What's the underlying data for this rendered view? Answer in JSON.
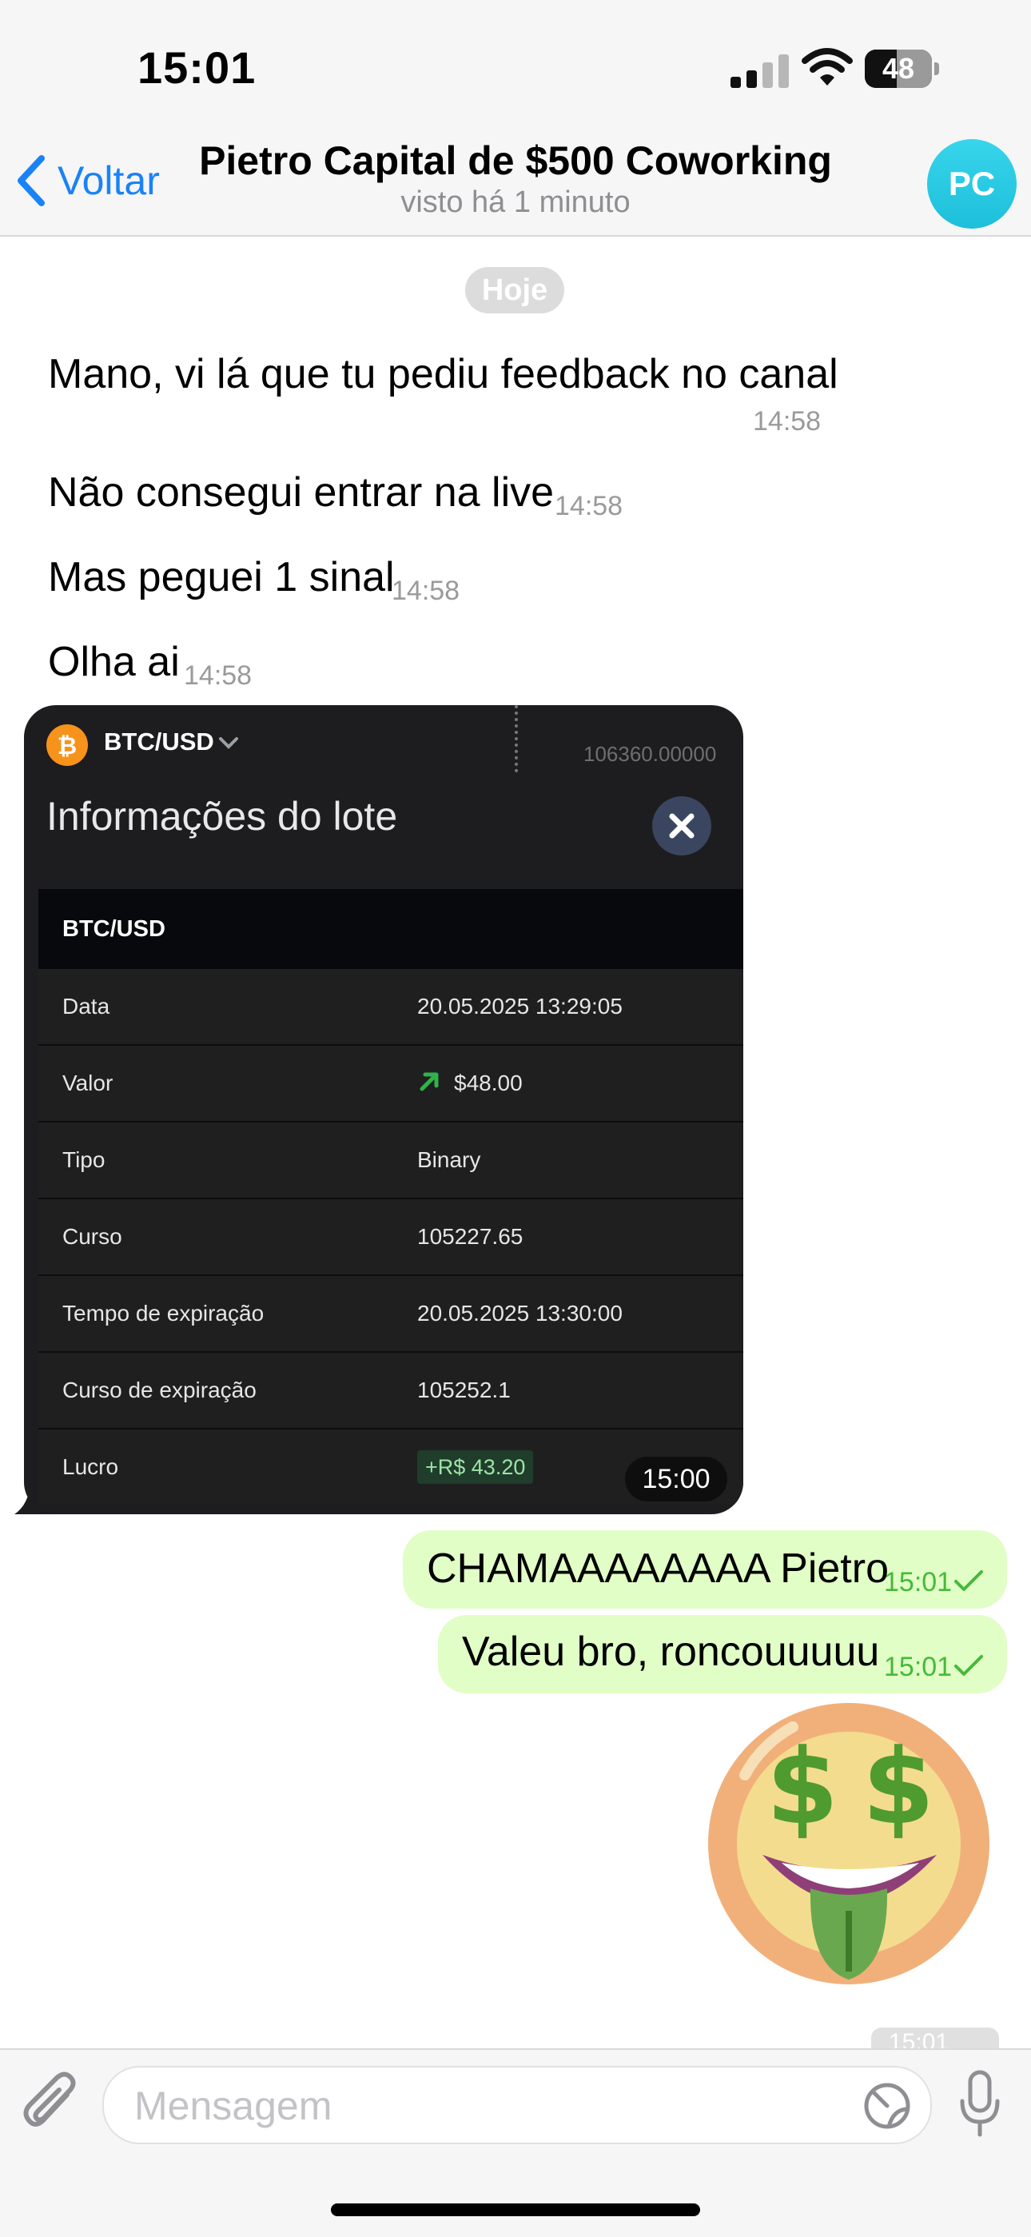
{
  "status_bar": {
    "time": "15:01",
    "battery": "48",
    "battery_level": 0.48
  },
  "header": {
    "back_label": "Voltar",
    "title": "Pietro Capital de $500 Coworking",
    "subtitle": "visto há 1 minuto",
    "avatar_initials": "PC"
  },
  "chat": {
    "date_label": "Hoje",
    "incoming": [
      {
        "text": "Mano, vi lá que tu pediu feedback no canal",
        "time": "14:58"
      },
      {
        "text": "Não consegui entrar na live",
        "time": "14:58"
      },
      {
        "text": "Mas peguei 1 sinal",
        "time": "14:58"
      },
      {
        "text": "Olha ai",
        "time": "14:58"
      }
    ],
    "image_time": "15:00",
    "outgoing": [
      {
        "text": "CHAMAAAAAAAA Pietro",
        "time": "15:01"
      },
      {
        "text": "Valeu bro, roncouuuuu",
        "time": "15:01"
      }
    ],
    "partial_time": "15:01"
  },
  "trade_card": {
    "asset": "BTC/USD",
    "price": "106360.00000",
    "title": "Informações do lote",
    "table_header": "BTC/USD",
    "rows": [
      {
        "label": "Data",
        "value": "20.05.2025 13:29:05"
      },
      {
        "label": "Valor",
        "value": "$48.00"
      },
      {
        "label": "Tipo",
        "value": "Binary"
      },
      {
        "label": "Curso",
        "value": "105227.65"
      },
      {
        "label": "Tempo de expiração",
        "value": "20.05.2025 13:30:00"
      },
      {
        "label": "Curso de expiração",
        "value": "105252.1"
      },
      {
        "label": "Lucro",
        "value": "+R$ 43.20"
      }
    ]
  },
  "composer": {
    "placeholder": "Mensagem"
  },
  "colors": {
    "accent": "#1a82f7",
    "outgoing_bubble": "#e1fec6",
    "read_check": "#46b93a",
    "card_bg": "#1d1d1f",
    "profit_badge_bg": "#1f3d2a"
  }
}
